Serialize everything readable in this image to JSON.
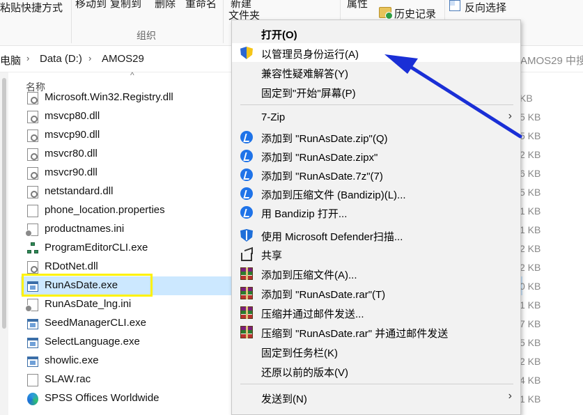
{
  "ribbon": {
    "paste_shortcut": "粘贴快捷方式",
    "move_to": "移动到",
    "copy_to": "复制到",
    "delete": "删除",
    "rename": "重命名",
    "new_folder_line1": "新建",
    "new_folder_line2": "文件夹",
    "properties": "属性",
    "history": "历史记录",
    "invert_selection": "反向选择",
    "group_organize": "组织"
  },
  "address": {
    "crumbs": [
      "电脑",
      "Data (D:)",
      "AMOS29"
    ],
    "search_placeholder": "AMOS29 中搜索"
  },
  "list": {
    "column_name": "名称",
    "files": [
      {
        "name": "Microsoft.Win32.Registry.dll",
        "icon": "dll-icon",
        "size": "KB"
      },
      {
        "name": "msvcp80.dll",
        "icon": "dll-icon",
        "size": "5 KB"
      },
      {
        "name": "msvcp90.dll",
        "icon": "dll-icon",
        "size": "5 KB"
      },
      {
        "name": "msvcr80.dll",
        "icon": "dll-icon",
        "size": "2 KB"
      },
      {
        "name": "msvcr90.dll",
        "icon": "dll-icon",
        "size": "6 KB"
      },
      {
        "name": "netstandard.dll",
        "icon": "dll-icon",
        "size": "5 KB"
      },
      {
        "name": "phone_location.properties",
        "icon": "document-icon",
        "size": "1 KB"
      },
      {
        "name": "productnames.ini",
        "icon": "ini-icon",
        "size": "1 KB"
      },
      {
        "name": "ProgramEditorCLI.exe",
        "icon": "tree-app-icon",
        "size": "2 KB"
      },
      {
        "name": "RDotNet.dll",
        "icon": "dll-icon",
        "size": "2 KB"
      },
      {
        "name": "RunAsDate.exe",
        "icon": "exe-icon",
        "size": "0 KB"
      },
      {
        "name": "RunAsDate_lng.ini",
        "icon": "ini-icon",
        "size": "1 KB"
      },
      {
        "name": "SeedManagerCLI.exe",
        "icon": "exe-icon",
        "size": "7 KB"
      },
      {
        "name": "SelectLanguage.exe",
        "icon": "exe-icon",
        "size": "5 KB"
      },
      {
        "name": "showlic.exe",
        "icon": "exe-icon",
        "size": "2 KB"
      },
      {
        "name": "SLAW.rac",
        "icon": "document-icon",
        "size": "4 KB"
      },
      {
        "name": "SPSS Offices Worldwide",
        "icon": "edge-icon",
        "size": "1 KB"
      }
    ]
  },
  "context_menu": {
    "items": [
      {
        "label": "打开(O)",
        "icon": ""
      },
      {
        "label": "以管理员身份运行(A)",
        "icon": "uac-shield-icon"
      },
      {
        "label": "兼容性疑难解答(Y)",
        "icon": ""
      },
      {
        "label": "固定到\"开始\"屏幕(P)",
        "icon": ""
      },
      {
        "label": "7-Zip",
        "icon": ""
      },
      {
        "label": "添加到 \"RunAsDate.zip\"(Q)",
        "icon": "bandizip-icon"
      },
      {
        "label": "添加到 \"RunAsDate.zipx\"",
        "icon": "bandizip-icon"
      },
      {
        "label": "添加到 \"RunAsDate.7z\"(7)",
        "icon": "bandizip-icon"
      },
      {
        "label": "添加到压缩文件 (Bandizip)(L)...",
        "icon": "bandizip-icon"
      },
      {
        "label": "用 Bandizip 打开...",
        "icon": "bandizip-icon"
      },
      {
        "label": "使用 Microsoft Defender扫描...",
        "icon": "defender-icon"
      },
      {
        "label": "共享",
        "icon": "share-icon"
      },
      {
        "label": "添加到压缩文件(A)...",
        "icon": "winrar-icon"
      },
      {
        "label": "添加到 \"RunAsDate.rar\"(T)",
        "icon": "winrar-icon"
      },
      {
        "label": "压缩并通过邮件发送...",
        "icon": "winrar-icon"
      },
      {
        "label": "压缩到 \"RunAsDate.rar\" 并通过邮件发送",
        "icon": "winrar-icon"
      },
      {
        "label": "固定到任务栏(K)",
        "icon": ""
      },
      {
        "label": "还原以前的版本(V)",
        "icon": ""
      },
      {
        "label": "发送到(N)",
        "icon": ""
      }
    ]
  },
  "colors": {
    "selection": "#cce8ff",
    "highlight_box": "#fff200",
    "annotation_arrow": "#1a2fd6",
    "menu_bg": "#f2f2f2"
  }
}
